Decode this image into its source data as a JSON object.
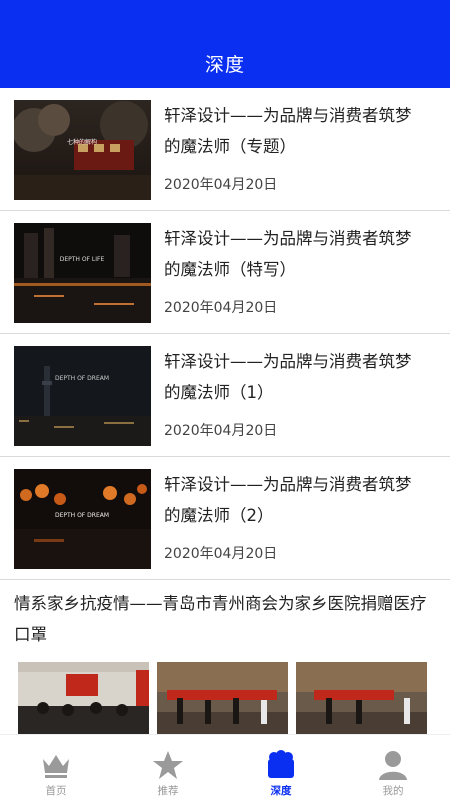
{
  "header": {
    "title": "深度",
    "background": "#0a2ff0"
  },
  "articles": [
    {
      "title": "轩泽设计——为品牌与消费者筑梦的魔法师（专题）",
      "date": "2020年04月20日",
      "thumb_caption": "七种的解构"
    },
    {
      "title": "轩泽设计——为品牌与消费者筑梦的魔法师（特写）",
      "date": "2020年04月20日",
      "thumb_caption": "DEPTH OF LIFE"
    },
    {
      "title": "轩泽设计——为品牌与消费者筑梦的魔法师（1）",
      "date": "2020年04月20日",
      "thumb_caption": "DEPTH OF DREAM"
    },
    {
      "title": "轩泽设计——为品牌与消费者筑梦的魔法师（2）",
      "date": "2020年04月20日",
      "thumb_caption": "DEPTH OF DREAM"
    }
  ],
  "gallery_post": {
    "title": "情系家乡抗疫情——青岛市青州商会为家乡医院捐赠医疗口罩"
  },
  "tabbar": {
    "active_color": "#0a2ff0",
    "inactive_color": "#999999",
    "items": [
      {
        "label": "首页",
        "icon": "crown-icon"
      },
      {
        "label": "推荐",
        "icon": "star-icon"
      },
      {
        "label": "深度",
        "icon": "layers-icon"
      },
      {
        "label": "我的",
        "icon": "user-icon"
      }
    ]
  }
}
